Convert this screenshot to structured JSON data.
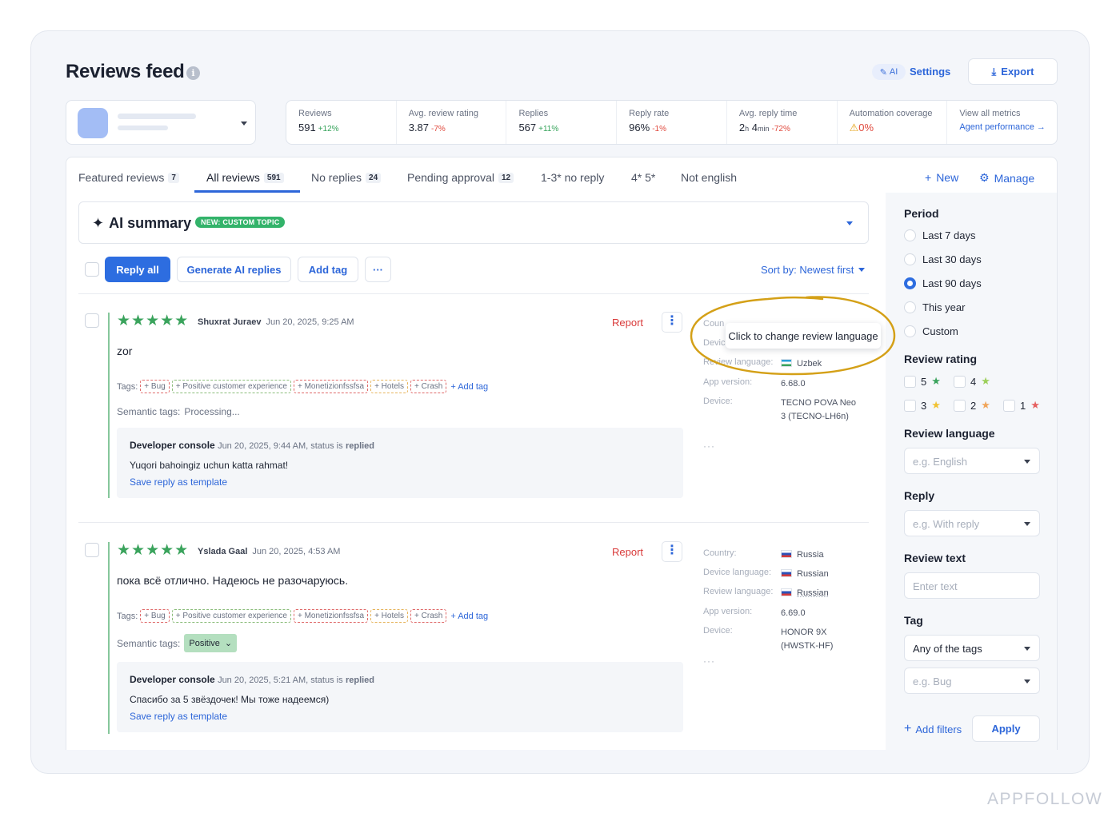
{
  "header": {
    "title": "Reviews feed",
    "info_icon": "i",
    "ai_label": "AI",
    "settings_label": "Settings",
    "export_label": "Export"
  },
  "metrics": [
    {
      "label": "Reviews",
      "value": "591",
      "delta": "+12%",
      "trend": "up"
    },
    {
      "label": "Avg. review rating",
      "value": "3.87",
      "delta": "-7%",
      "trend": "down"
    },
    {
      "label": "Replies",
      "value": "567",
      "delta": "+11%",
      "trend": "up"
    },
    {
      "label": "Reply rate",
      "value": "96%",
      "delta": "-1%",
      "trend": "down"
    },
    {
      "label": "Avg. reply time",
      "value_h": "2",
      "unit_h": "h",
      "value_m": "4",
      "unit_m": "min",
      "delta": "-72%",
      "trend": "down"
    },
    {
      "label": "Automation coverage",
      "value": "0%",
      "icon": "warning-icon"
    },
    {
      "label": "View all metrics",
      "link": "Agent performance →"
    }
  ],
  "tabs": [
    {
      "label": "Featured reviews",
      "count": "7"
    },
    {
      "label": "All reviews",
      "count": "591",
      "active": true
    },
    {
      "label": "No replies",
      "count": "24"
    },
    {
      "label": "Pending approval",
      "count": "12"
    },
    {
      "label": "1-3* no reply"
    },
    {
      "label": "4* 5*"
    },
    {
      "label": "Not english"
    }
  ],
  "tab_actions": {
    "new": "New",
    "manage": "Manage"
  },
  "ai_summary": {
    "title": "AI summary",
    "badge": "NEW: CUSTOM TOPIC"
  },
  "toolbar": {
    "reply_all": "Reply all",
    "generate": "Generate AI replies",
    "add_tag": "Add tag",
    "more": "···",
    "sort": "Sort by: Newest first"
  },
  "tags_common": {
    "label": "Tags:",
    "items": [
      "+ Bug",
      "+ Positive customer experience",
      "+ Monetizionfssfsa",
      "+ Hotels",
      "+ Crash"
    ],
    "add": "+ Add tag"
  },
  "reviews": [
    {
      "stars": "★★★★★",
      "author": "Shuxrat Juraev",
      "date": "Jun 20, 2025, 9:25 AM",
      "report": "Report",
      "text": "zor",
      "semantic_label": "Semantic tags:",
      "semantic_value": "Processing...",
      "dev_source": "Developer console",
      "dev_meta": "Jun 20, 2025, 9:44 AM, status is",
      "dev_status": "replied",
      "dev_reply": "Yuqori bahoingiz uchun katta rahmat!",
      "dev_link": "Save reply as template",
      "meta": {
        "country_k": "Coun",
        "device_lang_k": "Devic",
        "review_lang_k": "Review language:",
        "review_lang_v": "Uzbek",
        "app_version_k": "App version:",
        "app_version_v": "6.68.0",
        "device_k": "Device:",
        "device_v": "TECNO POVA Neo 3 (TECNO-LH6n)",
        "more": "···"
      }
    },
    {
      "stars": "★★★★★",
      "author": "Yslada Gaal",
      "date": "Jun 20, 2025, 4:53 AM",
      "report": "Report",
      "text": "пока всё отлично. Надеюсь не разочаруюсь.",
      "semantic_label": "Semantic tags:",
      "semantic_value": "Positive",
      "dev_source": "Developer console",
      "dev_meta": "Jun 20, 2025, 5:21 AM, status is",
      "dev_status": "replied",
      "dev_reply": "Спасибо за 5 звёздочек! Мы тоже надеемся)",
      "dev_link": "Save reply as template",
      "meta": {
        "country_k": "Country:",
        "country_v": "Russia",
        "device_lang_k": "Device language:",
        "device_lang_v": "Russian",
        "review_lang_k": "Review language:",
        "review_lang_v": "Russian",
        "app_version_k": "App version:",
        "app_version_v": "6.69.0",
        "device_k": "Device:",
        "device_v": "HONOR 9X (HWSTK-HF)",
        "more": "···"
      }
    }
  ],
  "tooltip": "Click to change review language",
  "filters": {
    "period_title": "Period",
    "period_options": [
      "Last 7 days",
      "Last 30 days",
      "Last 90 days",
      "This year",
      "Custom"
    ],
    "period_selected": 2,
    "rating_title": "Review rating",
    "ratings": [
      "5",
      "4",
      "3",
      "2",
      "1"
    ],
    "language_title": "Review language",
    "language_placeholder": "e.g. English",
    "reply_title": "Reply",
    "reply_placeholder": "e.g. With reply",
    "text_title": "Review text",
    "text_placeholder": "Enter text",
    "tag_title": "Tag",
    "tag_mode": "Any of the tags",
    "tag_placeholder": "e.g. Bug",
    "add_filters": "Add filters",
    "apply": "Apply"
  },
  "colors": {
    "accent": "#2d6de0",
    "green": "#3aa35c",
    "red": "#d93a3a",
    "highlight": "#d4a017"
  },
  "watermark": "APPFOLLOW"
}
